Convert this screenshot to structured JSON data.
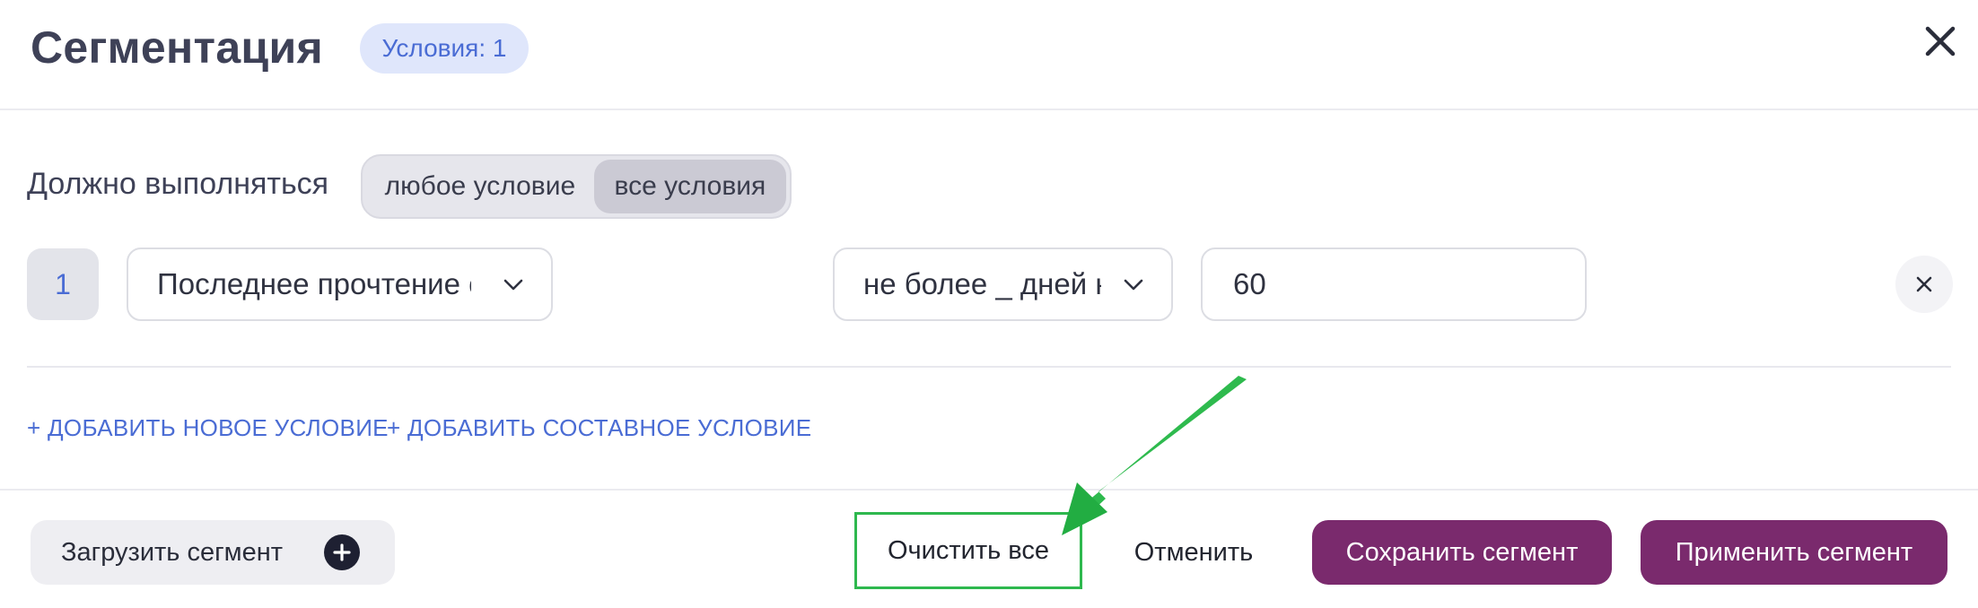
{
  "header": {
    "title": "Сегментация",
    "conditions_badge": "Условия: 1"
  },
  "match": {
    "label": "Должно выполняться",
    "options": [
      "любое условие",
      "все условия"
    ],
    "selected": "все условия"
  },
  "condition": {
    "number": "1",
    "field_value": "Последнее прочтение сообщения",
    "operator_value": "не более _ дней назад",
    "input_value": "60"
  },
  "links": {
    "add_condition": "+ ДОБАВИТЬ НОВОЕ УСЛОВИЕ",
    "add_compound": "+ ДОБАВИТЬ СОСТАВНОЕ УСЛОВИЕ"
  },
  "footer": {
    "load_segment": "Загрузить сегмент",
    "clear_all": "Очистить все",
    "cancel": "Отменить",
    "save_segment": "Сохранить сегмент",
    "apply_segment": "Применить сегмент"
  },
  "colors": {
    "accent_blue": "#4a6cd4",
    "primary_purple": "#7a2a6d",
    "highlight_green": "#2eb84e"
  },
  "icons": [
    "close-icon",
    "chevron-down-icon",
    "plus-circle-icon",
    "annotation-arrow"
  ]
}
